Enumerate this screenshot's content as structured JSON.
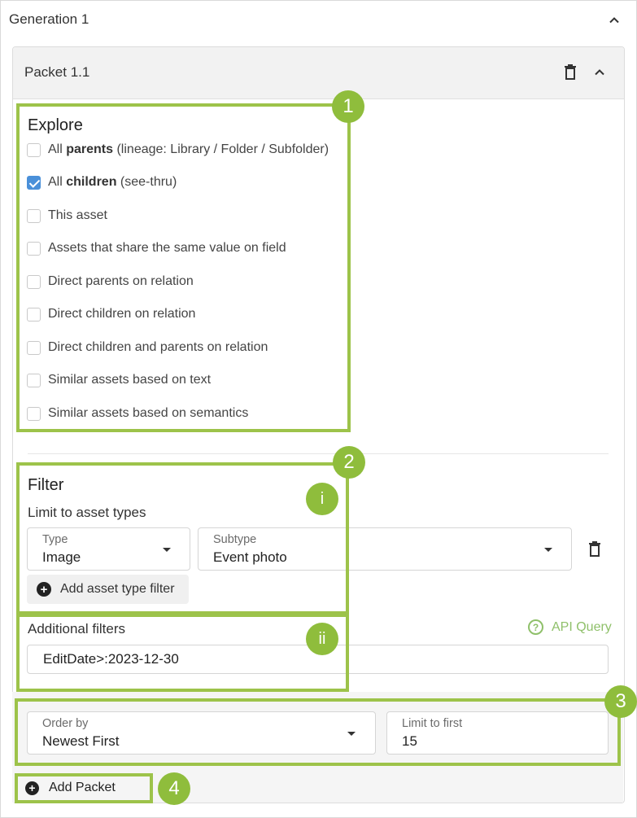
{
  "generation": {
    "title": "Generation 1"
  },
  "packet": {
    "title": "Packet 1.1"
  },
  "explore": {
    "title": "Explore",
    "options": [
      {
        "prefix": "All ",
        "bold": "parents",
        "suffix": " (lineage: Library / Folder / Subfolder)",
        "checked": false
      },
      {
        "prefix": "All ",
        "bold": "children",
        "suffix": " (see-thru)",
        "checked": true
      },
      {
        "prefix": "This asset",
        "bold": "",
        "suffix": "",
        "checked": false
      },
      {
        "prefix": "Assets that share the same value on field",
        "bold": "",
        "suffix": "",
        "checked": false
      },
      {
        "prefix": "Direct parents on relation",
        "bold": "",
        "suffix": "",
        "checked": false
      },
      {
        "prefix": "Direct children on relation",
        "bold": "",
        "suffix": "",
        "checked": false
      },
      {
        "prefix": "Direct children and parents on relation",
        "bold": "",
        "suffix": "",
        "checked": false
      },
      {
        "prefix": "Similar assets based on text",
        "bold": "",
        "suffix": "",
        "checked": false
      },
      {
        "prefix": "Similar assets based on semantics",
        "bold": "",
        "suffix": "",
        "checked": false
      }
    ]
  },
  "filter": {
    "title": "Filter",
    "limit_label": "Limit to asset types",
    "type_caption": "Type",
    "type_value": "Image",
    "subtype_caption": "Subtype",
    "subtype_value": "Event photo",
    "add_type_filter_label": "Add asset type filter",
    "additional_label": "Additional filters",
    "api_query_label": "API Query",
    "query_value": "EditDate>:2023-12-30"
  },
  "ordering": {
    "order_caption": "Order by",
    "order_value": "Newest First",
    "limit_caption": "Limit to first",
    "limit_value": "15"
  },
  "footer": {
    "add_packet_label": "Add Packet"
  },
  "annotations": {
    "badge1": "1",
    "badge2": "2",
    "badge3": "3",
    "badge4": "4",
    "badge_i": "i",
    "badge_ii": "ii"
  },
  "colors": {
    "accent_green": "#9dc34a",
    "checkbox_blue": "#4a90d9",
    "link_green": "#8fc06a"
  },
  "icons": {
    "collapse": "chevron-up-icon",
    "delete": "trash-icon",
    "add": "plus-circle-icon",
    "help": "question-circle-icon",
    "dropdown": "caret-down-icon"
  }
}
